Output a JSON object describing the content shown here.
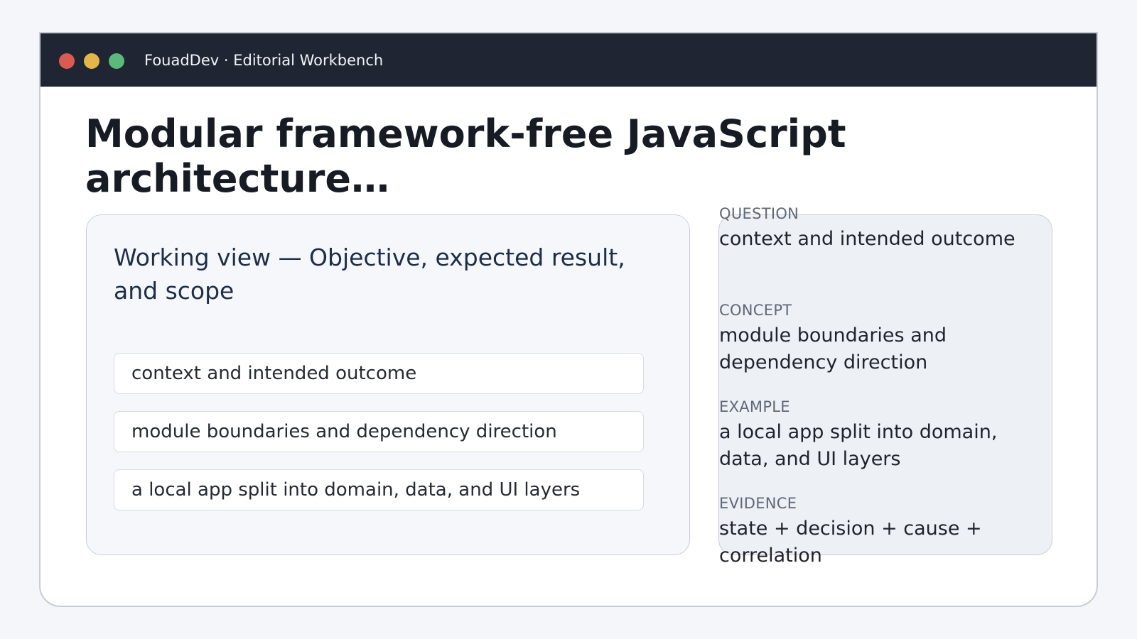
{
  "window": {
    "title": "FouadDev · Editorial Workbench",
    "controls": [
      "close",
      "minimize",
      "maximize"
    ]
  },
  "page": {
    "title": "Modular framework-free JavaScript architecture…"
  },
  "working_view": {
    "heading": "Working view — Objective, expected result, and scope",
    "items": [
      "context and intended outcome",
      "module boundaries and dependency direction",
      "a local app split into domain, data, and UI layers"
    ]
  },
  "summary": {
    "items": [
      {
        "label": "QUESTION",
        "value": "context and intended outcome"
      },
      {
        "label": "CONCEPT",
        "value": "module boundaries and dependency direction"
      },
      {
        "label": "EXAMPLE",
        "value": "a local app split into domain, data, and UI layers"
      },
      {
        "label": "EVIDENCE",
        "value": "state + decision + cause + correlation"
      }
    ]
  },
  "colors": {
    "titlebar": "#1f2532",
    "close": "#db5a52",
    "minimize": "#e4b548",
    "maximize": "#5cb97c",
    "heading": "#1e2d48"
  }
}
